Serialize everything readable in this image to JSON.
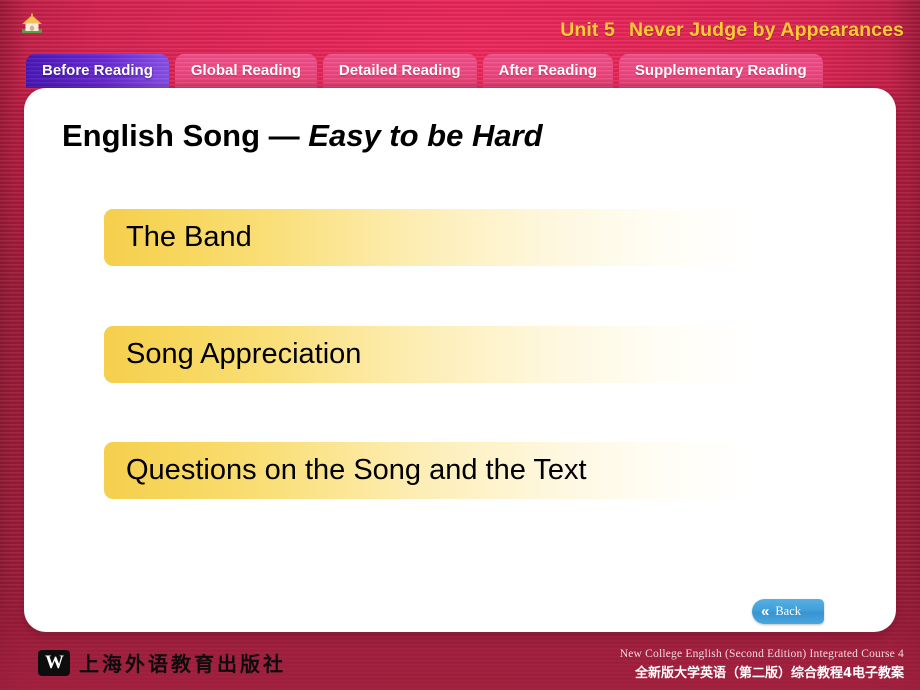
{
  "header": {
    "home_icon": "home-icon",
    "unit_number": "Unit 5",
    "unit_title": "Never Judge by Appearances",
    "accent_color": "#ffcc33"
  },
  "tabs": [
    {
      "label": "Before Reading",
      "active": true
    },
    {
      "label": "Global Reading",
      "active": false
    },
    {
      "label": "Detailed Reading",
      "active": false
    },
    {
      "label": "After Reading",
      "active": false
    },
    {
      "label": "Supplementary Reading",
      "active": false
    }
  ],
  "main": {
    "title_prefix": "English Song — ",
    "title_song": "Easy to be Hard",
    "menu_items": [
      {
        "label": "The Band"
      },
      {
        "label": "Song Appreciation"
      },
      {
        "label": "Questions on the Song and the Text"
      }
    ],
    "back_button": {
      "label": "Back",
      "icon": "double-chevron-left-icon",
      "glyph": "«",
      "color": "#3f9ed8"
    }
  },
  "footer": {
    "logo_mark": "W",
    "publisher_cn": "上海外语教育出版社",
    "course_en": "New College English (Second Edition) Integrated Course 4",
    "course_cn": "全新版大学英语（第二版）综合教程4电子教案"
  },
  "theme": {
    "background": "#e02456",
    "active_tab": "#6a2ad6",
    "inactive_tab": "#ef4a84",
    "menu_gold": "#f5cf4d",
    "card": "#ffffff"
  }
}
